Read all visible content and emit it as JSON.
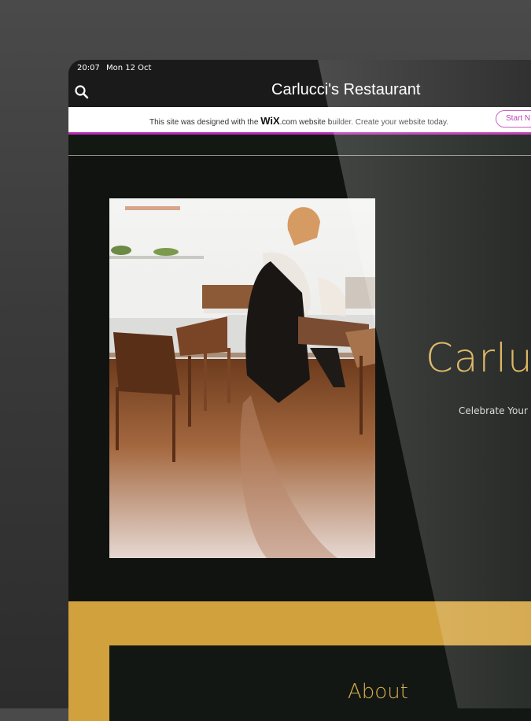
{
  "status_bar": {
    "time": "20:07",
    "date": "Mon 12 Oct"
  },
  "nav": {
    "title": "Carlucci's Restaurant"
  },
  "wix_banner": {
    "prefix": "This site was designed with the ",
    "logo": "WiX",
    "logo_suffix": ".com",
    "suffix": " website builder. Create your website today.",
    "button_label": "Start N"
  },
  "hero": {
    "title": "Carlucc",
    "subtitle": "Celebrate Your S"
  },
  "about": {
    "title": "About"
  },
  "colors": {
    "accent_gold": "#d1a13e",
    "title_gold": "#d7ae50",
    "background_dark": "#101310",
    "wix_purple": "#b52bb0"
  }
}
